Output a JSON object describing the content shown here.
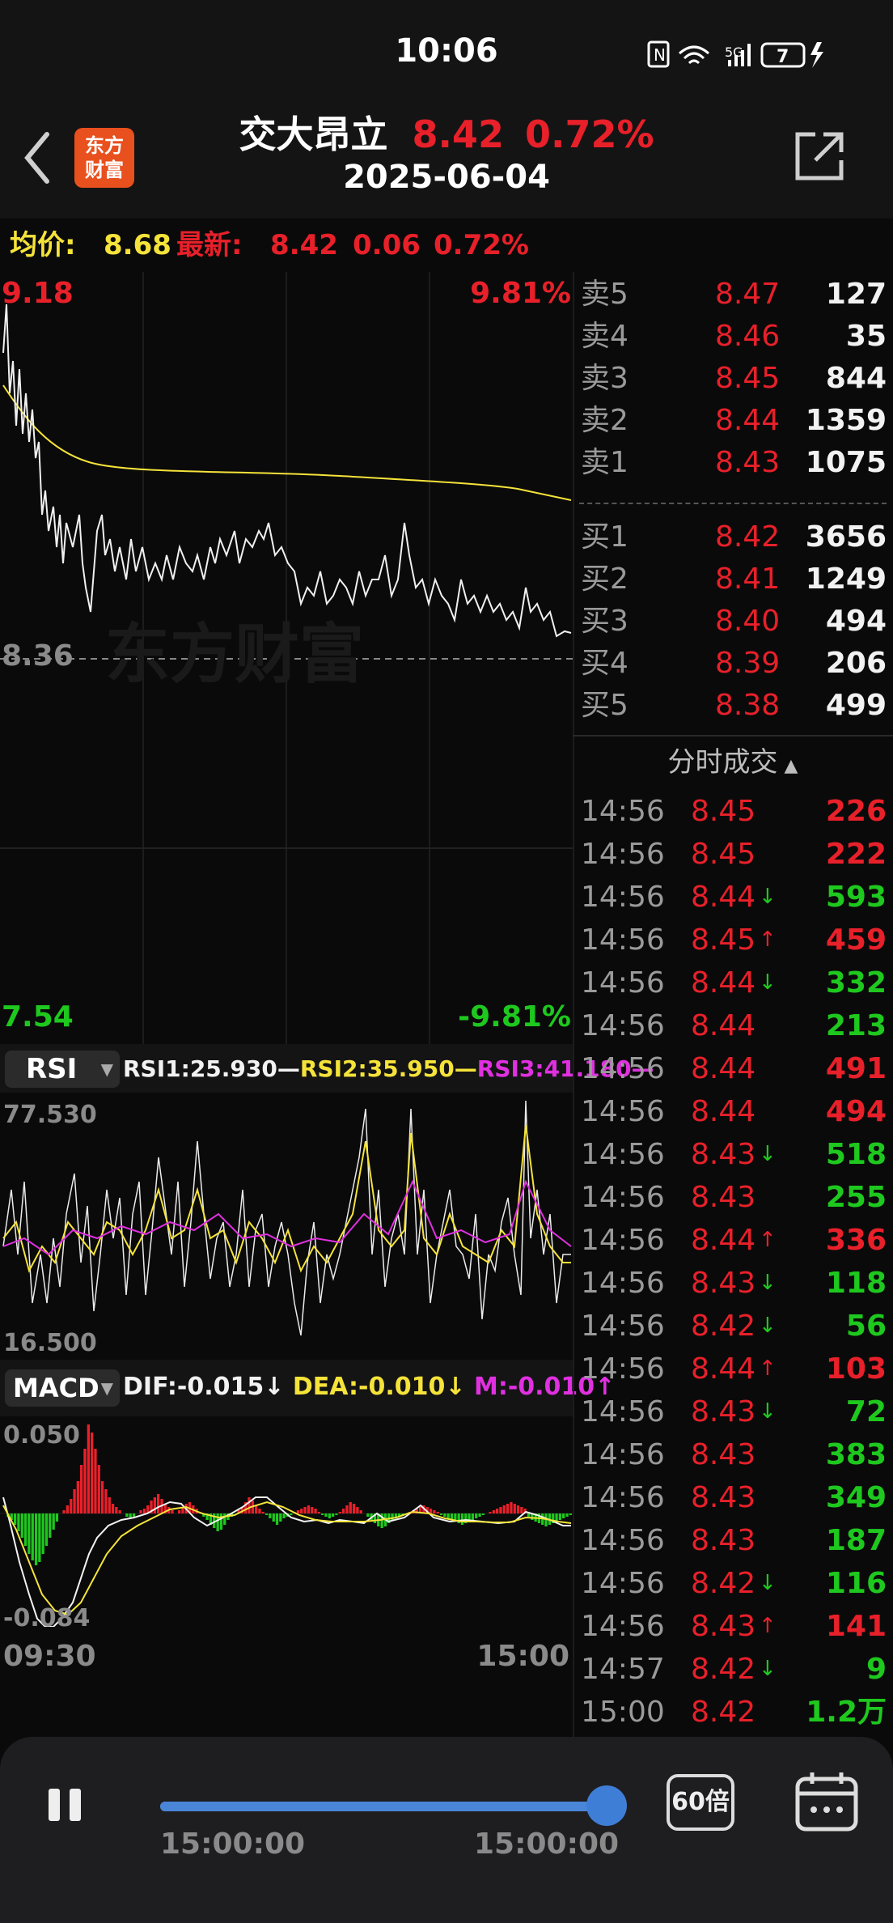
{
  "status_bar": {
    "time": "10:06",
    "signal_text": "5G",
    "battery": "7"
  },
  "header": {
    "logo_line1": "东方",
    "logo_line2": "财富",
    "stock_name": "交大昂立",
    "price": "8.42",
    "change_pct": "0.72%",
    "date": "2025-06-04"
  },
  "avg_bar": {
    "avg_label": "均价:",
    "avg_value": "8.68",
    "latest_label": "最新:",
    "latest_price": "8.42",
    "latest_change": "0.06",
    "latest_pct": "0.72%"
  },
  "price_chart": {
    "top_price": "9.18",
    "top_pct": "9.81%",
    "mid_price": "8.36",
    "bottom_price": "7.54",
    "bottom_pct": "-9.81%",
    "watermark": "东方财富"
  },
  "rsi": {
    "selector": "RSI",
    "rsi1": "RSI1:25.930",
    "rsi2": "RSI2:35.950",
    "rsi3": "RSI3:41.180",
    "top": "77.530",
    "bottom": "16.500"
  },
  "macd": {
    "selector": "MACD",
    "dif": "DIF:-0.015",
    "dif_arrow": "↓",
    "dea": "DEA:-0.010",
    "dea_arrow": "↓",
    "m": "M:-0.010",
    "m_arrow": "↑",
    "top": "0.050",
    "bottom": "-0.084"
  },
  "time_axis": {
    "start": "09:30",
    "end": "15:00"
  },
  "order_book": {
    "asks": [
      {
        "label": "卖5",
        "price": "8.47",
        "vol": "127"
      },
      {
        "label": "卖4",
        "price": "8.46",
        "vol": "35"
      },
      {
        "label": "卖3",
        "price": "8.45",
        "vol": "844"
      },
      {
        "label": "卖2",
        "price": "8.44",
        "vol": "1359"
      },
      {
        "label": "卖1",
        "price": "8.43",
        "vol": "1075"
      }
    ],
    "bids": [
      {
        "label": "买1",
        "price": "8.42",
        "vol": "3656"
      },
      {
        "label": "买2",
        "price": "8.41",
        "vol": "1249"
      },
      {
        "label": "买3",
        "price": "8.40",
        "vol": "494"
      },
      {
        "label": "买4",
        "price": "8.39",
        "vol": "206"
      },
      {
        "label": "买5",
        "price": "8.38",
        "vol": "499"
      }
    ]
  },
  "trades": {
    "title": "分时成交",
    "rows": [
      {
        "time": "14:56",
        "price": "8.45",
        "arrow": "",
        "vol": "226",
        "color": "red"
      },
      {
        "time": "14:56",
        "price": "8.45",
        "arrow": "",
        "vol": "222",
        "color": "red"
      },
      {
        "time": "14:56",
        "price": "8.44",
        "arrow": "↓",
        "vol": "593",
        "color": "green"
      },
      {
        "time": "14:56",
        "price": "8.45",
        "arrow": "↑",
        "vol": "459",
        "color": "red"
      },
      {
        "time": "14:56",
        "price": "8.44",
        "arrow": "↓",
        "vol": "332",
        "color": "green"
      },
      {
        "time": "14:56",
        "price": "8.44",
        "arrow": "",
        "vol": "213",
        "color": "green"
      },
      {
        "time": "14:56",
        "price": "8.44",
        "arrow": "",
        "vol": "491",
        "color": "red"
      },
      {
        "time": "14:56",
        "price": "8.44",
        "arrow": "",
        "vol": "494",
        "color": "red"
      },
      {
        "time": "14:56",
        "price": "8.43",
        "arrow": "↓",
        "vol": "518",
        "color": "green"
      },
      {
        "time": "14:56",
        "price": "8.43",
        "arrow": "",
        "vol": "255",
        "color": "green"
      },
      {
        "time": "14:56",
        "price": "8.44",
        "arrow": "↑",
        "vol": "336",
        "color": "red"
      },
      {
        "time": "14:56",
        "price": "8.43",
        "arrow": "↓",
        "vol": "118",
        "color": "green"
      },
      {
        "time": "14:56",
        "price": "8.42",
        "arrow": "↓",
        "vol": "56",
        "color": "green"
      },
      {
        "time": "14:56",
        "price": "8.44",
        "arrow": "↑",
        "vol": "103",
        "color": "red"
      },
      {
        "time": "14:56",
        "price": "8.43",
        "arrow": "↓",
        "vol": "72",
        "color": "green"
      },
      {
        "time": "14:56",
        "price": "8.43",
        "arrow": "",
        "vol": "383",
        "color": "green"
      },
      {
        "time": "14:56",
        "price": "8.43",
        "arrow": "",
        "vol": "349",
        "color": "green"
      },
      {
        "time": "14:56",
        "price": "8.43",
        "arrow": "",
        "vol": "187",
        "color": "green"
      },
      {
        "time": "14:56",
        "price": "8.42",
        "arrow": "↓",
        "vol": "116",
        "color": "green"
      },
      {
        "time": "14:56",
        "price": "8.43",
        "arrow": "↑",
        "vol": "141",
        "color": "red"
      },
      {
        "time": "14:57",
        "price": "8.42",
        "arrow": "↓",
        "vol": "9",
        "color": "green"
      },
      {
        "time": "15:00",
        "price": "8.42",
        "arrow": "",
        "vol": "1.2万",
        "color": "green"
      }
    ]
  },
  "playback": {
    "start_time": "15:00:00",
    "end_time": "15:00:00",
    "speed": "60倍",
    "progress": 1.0
  },
  "colors": {
    "up": "#e8202a",
    "down": "#1ec81e",
    "avg_line": "#f5e33a",
    "rsi3": "#e030e0"
  }
}
